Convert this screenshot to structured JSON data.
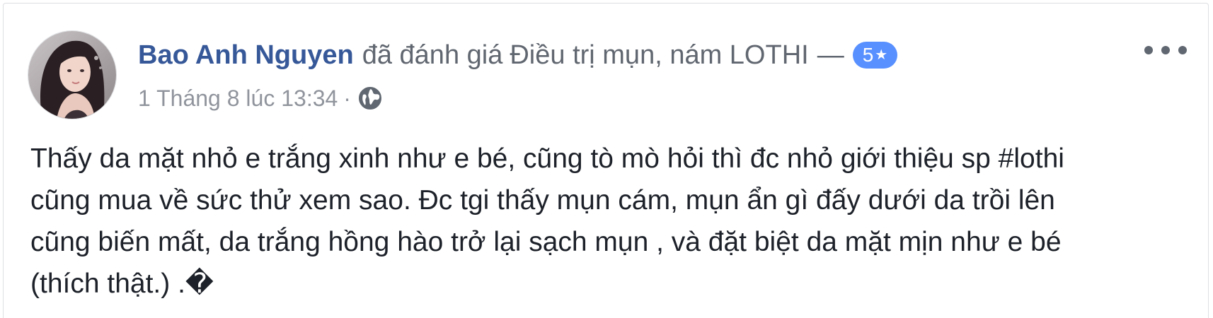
{
  "post": {
    "author": "Bao Anh Nguyen",
    "action_text": "đã đánh giá",
    "page_name": "Điều trị mụn, nám LOTHI",
    "dash": "—",
    "rating_value": "5",
    "rating_star": "★",
    "timestamp": "1 Tháng 8 lúc 13:34",
    "separator": "·",
    "privacy_icon": "globe-icon",
    "more_icon": "more-options-icon",
    "text": "Thấy da mặt nhỏ e trắng xinh như e bé, cũng tò mò hỏi thì đc nhỏ giới thiệu sp #lothi\ncũng mua về sức thử xem sao. Đc tgi thấy mụn cám, mụn ẩn gì đấy dưới da trồi lên\ncũng biến mất, da trắng hồng hào trở lại sạch mụn , và đặt biệt da mặt mịn như e bé\n(thích thật.) .�"
  },
  "colors": {
    "author_link": "#365899",
    "secondary_text": "#616770",
    "meta_text": "#90949c",
    "badge_bg": "#5890ff",
    "body_text": "#1d2129",
    "card_border": "#dddfe2"
  }
}
